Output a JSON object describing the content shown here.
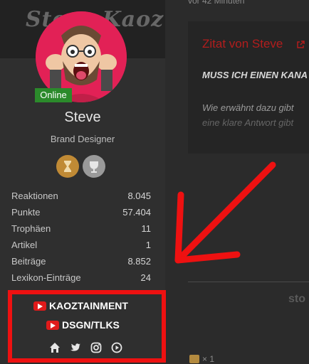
{
  "top": {
    "time_text": "vor 42 Minuten"
  },
  "banner": {
    "text": "Steve Kaoz"
  },
  "profile": {
    "status": "Online",
    "username": "Steve",
    "role": "Brand Designer"
  },
  "stats": [
    {
      "label": "Reaktionen",
      "value": "8.045"
    },
    {
      "label": "Punkte",
      "value": "57.404"
    },
    {
      "label": "Trophäen",
      "value": "11"
    },
    {
      "label": "Artikel",
      "value": "1"
    },
    {
      "label": "Beiträge",
      "value": "8.852"
    },
    {
      "label": "Lexikon-Einträge",
      "value": "24"
    }
  ],
  "signature": {
    "channel1": "KAOZTAINMENT",
    "channel2": "DSGN/TLKS",
    "icons": [
      "home-icon",
      "twitter-icon",
      "instagram-icon",
      "play-icon"
    ]
  },
  "quote": {
    "title": "Zitat von Steve",
    "bold_line": "MUSS ICH EINEN KANA",
    "line1": "Wie erwähnt dazu gibt",
    "line2": "eine klare Antwort gibt"
  },
  "right": {
    "partial_text": "sto",
    "likes": "× 1"
  },
  "colors": {
    "accent_red": "#ee1111",
    "online_green": "#2b8a2b",
    "youtube_red": "#e01b1b",
    "quote_red": "#b21d1d"
  }
}
